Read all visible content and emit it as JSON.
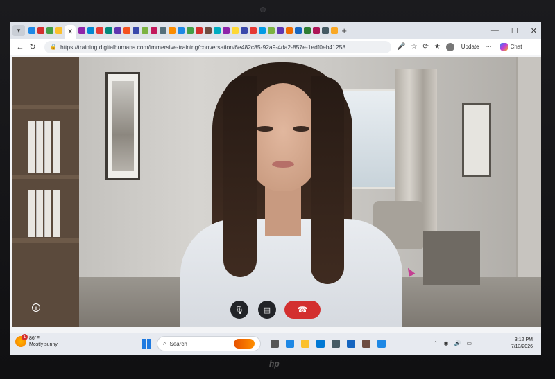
{
  "browser": {
    "url": "https://training.digitalhumans.com/immersive-training/conversation/6e482c85-92a9-4da2-857e-1edf0eb41258",
    "update_label": "Update",
    "chat_label": "Chat",
    "icons": [
      "back-icon",
      "refresh-icon",
      "lock-icon",
      "mic-icon",
      "star-icon",
      "sync-icon",
      "favorites-icon",
      "profile-icon",
      "close-icon",
      "new-tab-icon",
      "minimize-icon",
      "maximize-icon"
    ],
    "tab_colors": [
      "#1e88e5",
      "#d32f2f",
      "#43a047",
      "#fbc02d",
      "#8e24aa",
      "#0288d1",
      "#e53935",
      "#00897b",
      "#5e35b1",
      "#f4511e",
      "#3949ab",
      "#7cb342",
      "#c2185b",
      "#546e7a",
      "#fb8c00",
      "#1e88e5",
      "#43a047",
      "#d32f2f",
      "#6d4c41",
      "#00acc1",
      "#8e24aa",
      "#fdd835",
      "#3949ab",
      "#e53935",
      "#039be5",
      "#7cb342",
      "#5e35b1",
      "#ef6c00",
      "#1565c0",
      "#2e7d32",
      "#ad1457",
      "#455a64",
      "#f9a825"
    ]
  },
  "call": {
    "controls": [
      "mic-icon",
      "chat-icon",
      "hang-up-icon"
    ],
    "info": "i",
    "colors": {
      "end_call": "#d32f2f",
      "control_bg": "#222428"
    }
  },
  "taskbar": {
    "weather_temp": "86°F",
    "weather_desc": "Mostly sunny",
    "weather_badge": "1",
    "search_placeholder": "Search",
    "clock_time": "3:12 PM",
    "clock_date": "7/13/2026",
    "tray_icons": [
      "chevron-up-icon",
      "network-icon",
      "volume-icon",
      "battery-icon"
    ]
  },
  "device": {
    "brand": "hp"
  }
}
